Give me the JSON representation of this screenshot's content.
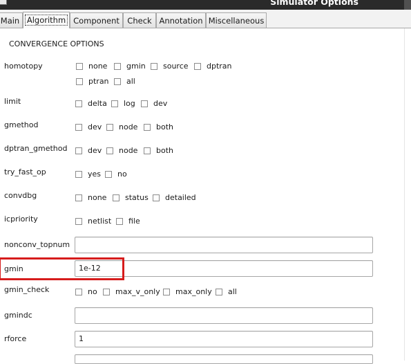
{
  "window": {
    "title": "Simulator Options"
  },
  "tabs": [
    {
      "label": "Main"
    },
    {
      "label": "Algorithm"
    },
    {
      "label": "Component"
    },
    {
      "label": "Check"
    },
    {
      "label": "Annotation"
    },
    {
      "label": "Miscellaneous"
    }
  ],
  "section_title": "CONVERGENCE OPTIONS",
  "options": {
    "homotopy": {
      "label": "homotopy",
      "choices": [
        "none",
        "gmin",
        "source",
        "dptran",
        "ptran",
        "all"
      ]
    },
    "limit": {
      "label": "limit",
      "choices": [
        "delta",
        "log",
        "dev"
      ]
    },
    "gmethod": {
      "label": "gmethod",
      "choices": [
        "dev",
        "node",
        "both"
      ]
    },
    "dptran_gmethod": {
      "label": "dptran_gmethod",
      "choices": [
        "dev",
        "node",
        "both"
      ]
    },
    "try_fast_op": {
      "label": "try_fast_op",
      "choices": [
        "yes",
        "no"
      ]
    },
    "convdbg": {
      "label": "convdbg",
      "choices": [
        "none",
        "status",
        "detailed"
      ]
    },
    "icpriority": {
      "label": "icpriority",
      "choices": [
        "netlist",
        "file"
      ]
    },
    "gmin_check": {
      "label": "gmin_check",
      "choices": [
        "no",
        "max_v_only",
        "max_only",
        "all"
      ]
    }
  },
  "fields": {
    "nonconv_topnum": {
      "label": "nonconv_topnum",
      "value": ""
    },
    "gmin": {
      "label": "gmin",
      "value": "1e-12"
    },
    "gmindc": {
      "label": "gmindc",
      "value": ""
    },
    "rforce": {
      "label": "rforce",
      "value": "1"
    }
  },
  "colors": {
    "highlight": "#d61c1c",
    "titlebar": "#2a2a2a"
  }
}
